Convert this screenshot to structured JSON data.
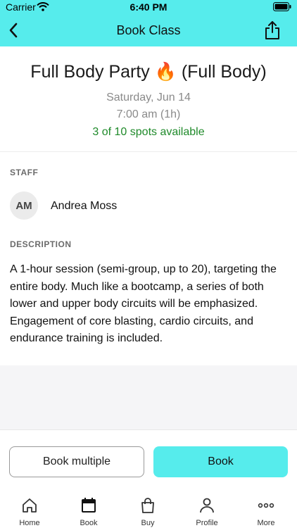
{
  "status_bar": {
    "carrier": "Carrier",
    "time": "6:40 PM"
  },
  "nav": {
    "title": "Book Class",
    "back_icon": "chevron-left-icon",
    "share_icon": "share-icon"
  },
  "class_info": {
    "title": "Full Body Party 🔥 (Full Body)",
    "date": "Saturday, Jun 14",
    "time": "7:00 am (1h)",
    "spots": "3 of 10 spots available"
  },
  "staff": {
    "section_label": "STAFF",
    "initials": "AM",
    "name": "Andrea Moss"
  },
  "description": {
    "section_label": "DESCRIPTION",
    "text": "A 1-hour session (semi-group, up to 20), targeting the entire body. Much like a bootcamp, a series of both lower and upper body circuits will be emphasized. Engagement of core blasting, cardio circuits, and endurance training is included."
  },
  "actions": {
    "book_multiple_label": "Book multiple",
    "book_label": "Book"
  },
  "tabs": [
    {
      "label": "Home",
      "icon": "home-icon"
    },
    {
      "label": "Book",
      "icon": "calendar-icon"
    },
    {
      "label": "Buy",
      "icon": "shopping-bag-icon"
    },
    {
      "label": "Profile",
      "icon": "person-icon"
    },
    {
      "label": "More",
      "icon": "more-dots-icon"
    }
  ],
  "colors": {
    "accent": "#56ecec",
    "spots_green": "#1f8a2a"
  }
}
